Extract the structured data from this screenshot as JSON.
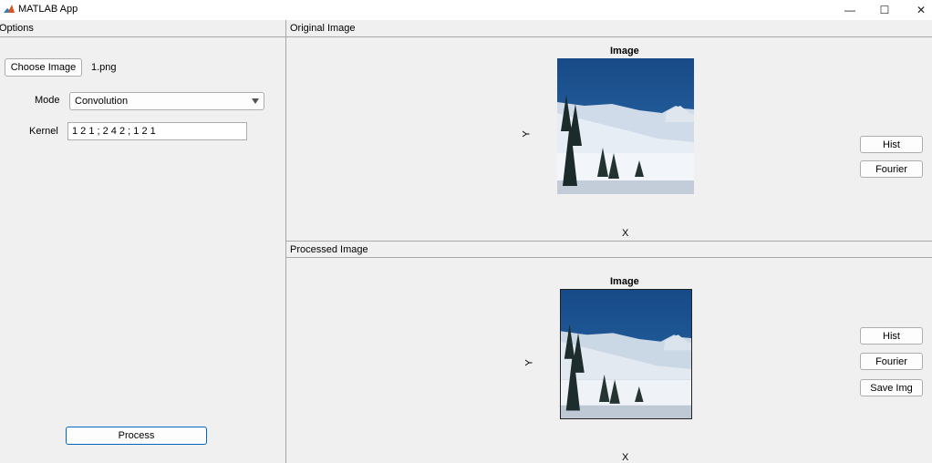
{
  "window": {
    "title": "MATLAB App",
    "minimize_glyph": "—",
    "maximize_glyph": "☐",
    "close_glyph": "✕",
    "icon": "matlab-logo-icon"
  },
  "options": {
    "title": "Options",
    "choose_image_label": "Choose Image",
    "file_name": "1.png",
    "mode_label": "Mode",
    "mode_value": "Convolution",
    "kernel_label": "Kernel",
    "kernel_value": "1 2 1 ; 2 4 2 ; 1 2 1",
    "process_label": "Process"
  },
  "original": {
    "title": "Original Image",
    "axes_title": "Image",
    "xlabel": "X",
    "ylabel": "Y",
    "hist_label": "Hist",
    "fourier_label": "Fourier"
  },
  "processed": {
    "title": "Processed Image",
    "axes_title": "Image",
    "xlabel": "X",
    "ylabel": "Y",
    "hist_label": "Hist",
    "fourier_label": "Fourier",
    "save_label": "Save Img"
  },
  "colors": {
    "primary_border": "#0067c0",
    "sky": "#1d4f87",
    "snow": "#e9eef3"
  }
}
